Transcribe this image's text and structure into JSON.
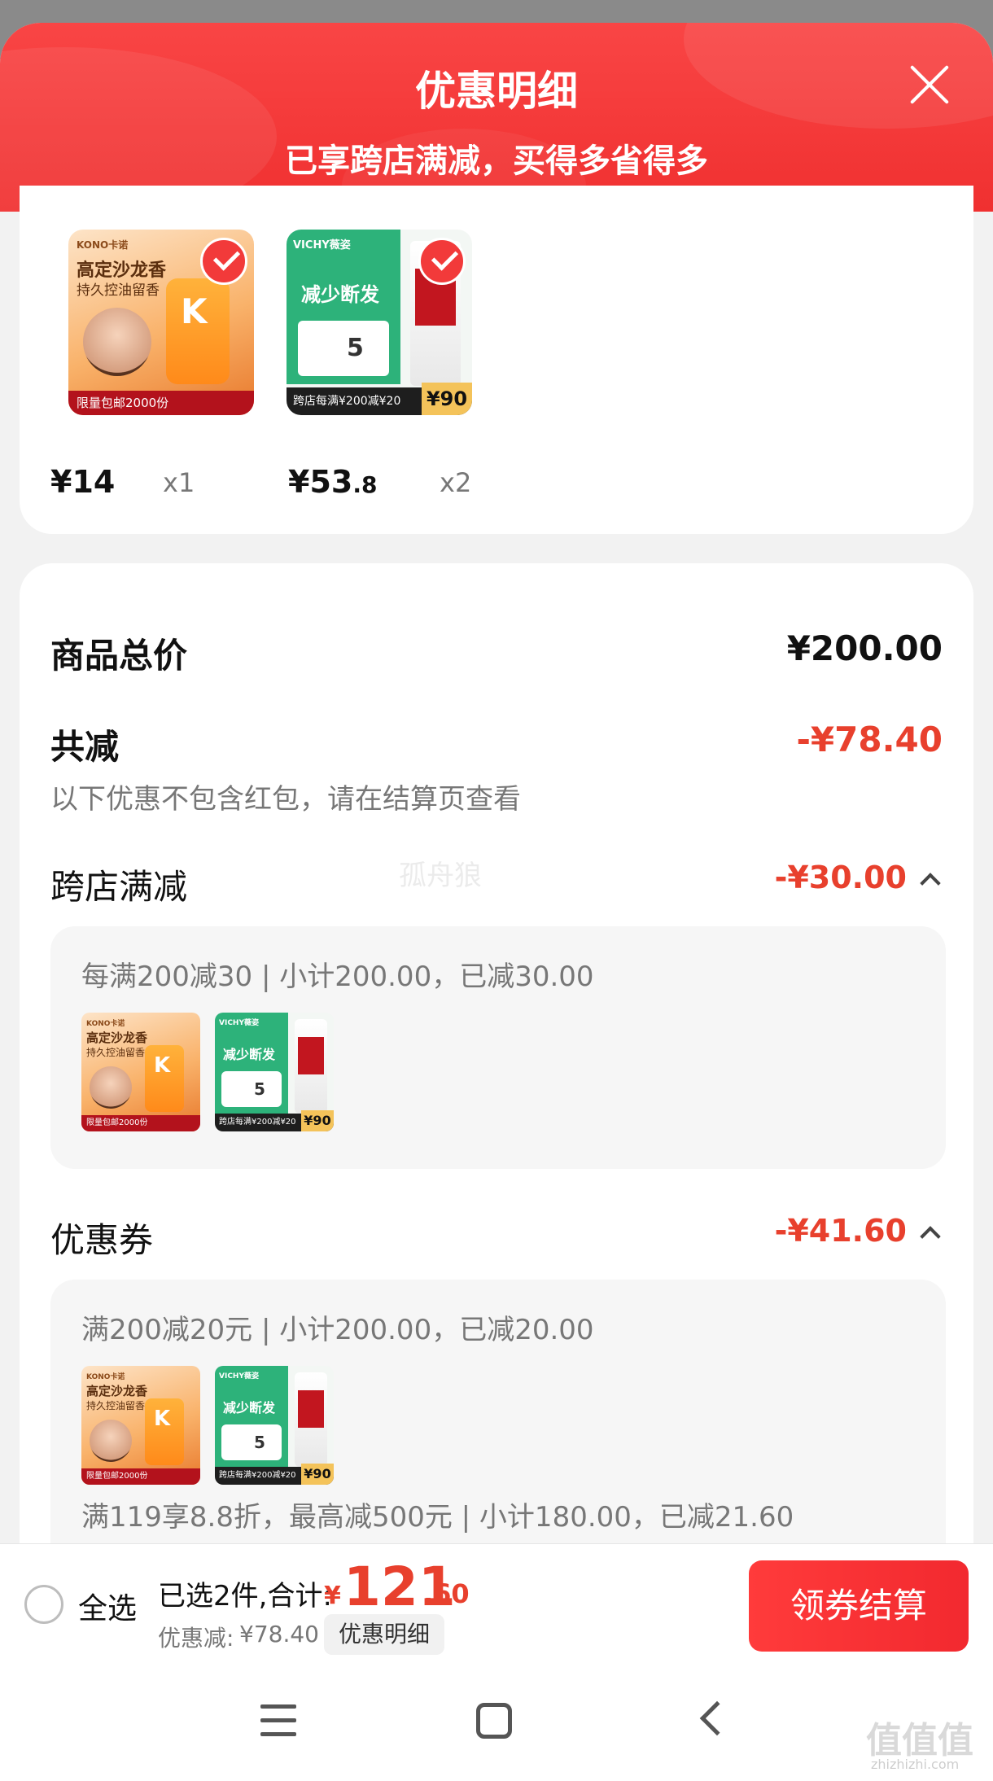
{
  "header": {
    "title": "优惠明细",
    "subtitle": "已享跨店满减，买得多省得多"
  },
  "products": [
    {
      "thumb": {
        "brand": "KONO卡诺",
        "line1": "高定沙龙香",
        "line2": "持久控油留香",
        "badge": "限量包邮2000份"
      },
      "price": "¥14",
      "price_decimal": "",
      "qty": "x1"
    },
    {
      "thumb": {
        "brand": "VICHY薇姿",
        "line1": "减少断发",
        "badge": "跨店每满¥200减¥20",
        "tag": "¥90",
        "card_value": "5"
      },
      "price": "¥53",
      "price_decimal": ".8",
      "qty": "x2"
    }
  ],
  "summary": {
    "total_label": "商品总价",
    "total_value": "¥200.00",
    "discount_label": "共减",
    "discount_value": "-¥78.40",
    "note": "以下优惠不包含红包，请在结算页查看"
  },
  "sections": [
    {
      "label": "跨店满减",
      "amount": "-¥30.00",
      "lines": [
        "每满200减30 | 小计200.00，已减30.00"
      ]
    },
    {
      "label": "优惠券",
      "amount": "-¥41.60",
      "lines": [
        "满200减20元 | 小计200.00，已减20.00",
        "满119享8.8折，最高减500元 | 小计180.00，已减21.60"
      ]
    }
  ],
  "watermark": "孤舟狼",
  "bottom": {
    "select_all": "全选",
    "selected_text": "已选2件,合计:",
    "total_currency": "¥",
    "total_int": "121",
    "total_dec": ".60",
    "discount_label": "优惠减:",
    "discount_value": "¥78.40",
    "detail_button": "优惠明细",
    "checkout_button": "领券结算"
  },
  "site_watermark": {
    "big": "值值值",
    "small": "zhizhizhi.com"
  },
  "colors": {
    "accent_red": "#e8402d",
    "header_red": "#f23a3a"
  }
}
